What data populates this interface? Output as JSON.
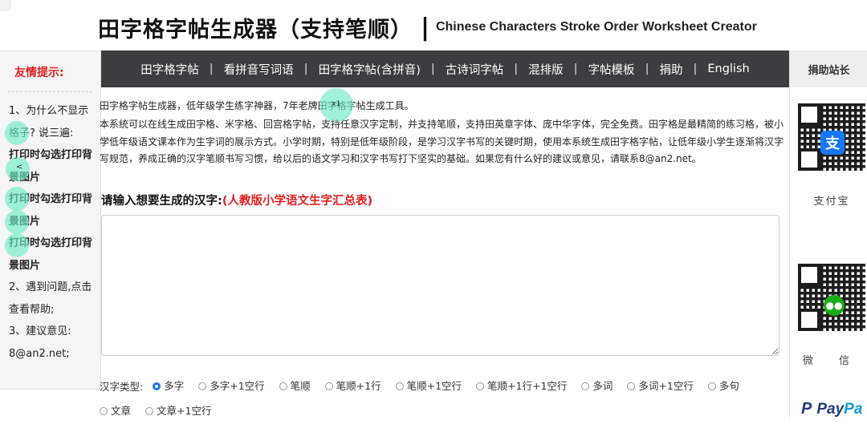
{
  "header": {
    "title_cn": "田字格字帖生成器（支持笔顺）",
    "separator": "|",
    "title_en": "Chinese Characters Stroke Order Worksheet Creator"
  },
  "nav": {
    "items": [
      "田字格字帖",
      "看拼音写词语",
      "田字格字帖(含拼音)",
      "古诗词字帖",
      "混排版",
      "字帖模板",
      "捐助",
      "English"
    ],
    "separator": "|"
  },
  "left_sidebar": {
    "title": "友情提示:",
    "tips": [
      {
        "text": "1、为什么不显示",
        "bold": false
      },
      {
        "text": "格子? 说三遍:",
        "bold": false
      },
      {
        "text": "打印时勾选打印背",
        "bold": true
      },
      {
        "text": "景图片",
        "bold": true
      },
      {
        "text": "打印时勾选打印背",
        "bold": true
      },
      {
        "text": "景图片",
        "bold": true
      },
      {
        "text": "打印时勾选打印背",
        "bold": true
      },
      {
        "text": "景图片",
        "bold": true
      },
      {
        "text": "2、遇到问题,点击",
        "bold": false
      },
      {
        "text": "查看帮助;",
        "bold": false
      },
      {
        "text": "3、建议意见:",
        "bold": false
      },
      {
        "text": "8@an2.net;",
        "bold": false
      }
    ]
  },
  "right_sidebar": {
    "title": "捐助站长",
    "alipay_label": "支付宝",
    "wechat_label": "微 信",
    "paypal_pay": "Pay",
    "paypal_pal": "Pa"
  },
  "content": {
    "intro_line1": "田字格字帖生成器，低年级学生练字神器，7年老牌田字格字帖生成工具。",
    "intro_paragraph": "本系统可以在线生成田字格、米字格、回宫格字帖，支持任意汉字定制，并支持笔顺，支持田英章字体、庞中华字体，完全免费。田字格是最精简的练习格，被小学低年级语文课本作为生字词的展示方式。小学时期，特别是低年级阶段，是学习汉字书写的关键时期，使用本系统生成田字格字帖，让低年级小学生逐渐将汉字写规范，养成正确的汉字笔顺书写习惯，给以后的语文学习和汉字书写打下坚实的基础。如果您有什么好的建议或意见，请联系8@an2.net。",
    "prompt_label": "请输入想要生成的汉字:",
    "prompt_link": "(人教版小学语文生字汇总表)",
    "textarea_value": "",
    "type_label": "汉字类型:",
    "type_options": [
      {
        "label": "多字",
        "selected": true
      },
      {
        "label": "多字+1空行",
        "selected": false
      },
      {
        "label": "笔顺",
        "selected": false
      },
      {
        "label": "笔顺+1行",
        "selected": false
      },
      {
        "label": "笔顺+1空行",
        "selected": false
      },
      {
        "label": "笔顺+1行+1空行",
        "selected": false
      },
      {
        "label": "多词",
        "selected": false
      },
      {
        "label": "多词+1空行",
        "selected": false
      },
      {
        "label": "多句",
        "selected": false
      },
      {
        "label": "文章",
        "selected": false
      },
      {
        "label": "文章+1空行",
        "selected": false
      }
    ]
  },
  "overlay": {
    "touch_label": "x1",
    "back_label": "<"
  },
  "colors": {
    "nav_bg": "#3d3d3f",
    "accent_red": "#e02020",
    "radio_selected": "#1a73e8",
    "touch_marker": "#6eebc8"
  }
}
